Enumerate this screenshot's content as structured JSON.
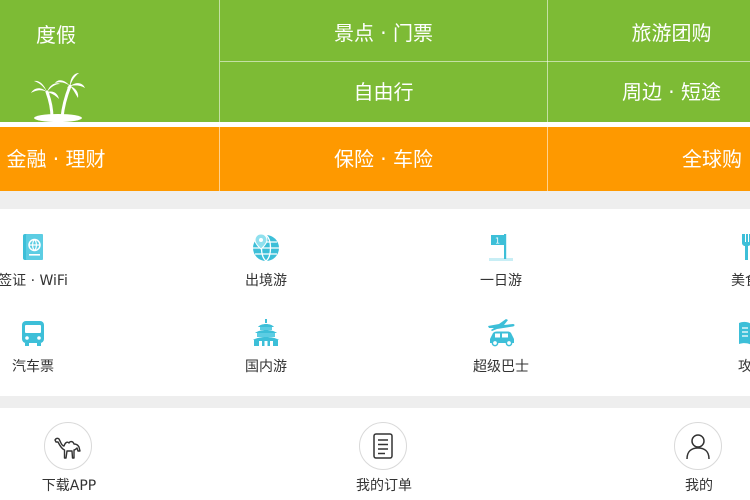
{
  "colors": {
    "green": "#7dbb35",
    "orange": "#fe9900",
    "icon_cyan": "#3dbfd8",
    "separator": "#eeeeee"
  },
  "green_menu": {
    "vacation": {
      "label": "度假",
      "icon": "palm-tree-icon"
    },
    "items": [
      {
        "label": "景点 · 门票"
      },
      {
        "label": "旅游团购"
      },
      {
        "label": "自由行"
      },
      {
        "label": "周边 · 短途"
      }
    ]
  },
  "orange_menu": {
    "items": [
      {
        "label": "金融 · 理财"
      },
      {
        "label": "保险 · 车险"
      },
      {
        "label": "全球购"
      }
    ]
  },
  "icon_grid": {
    "row1": [
      {
        "label": "签证 · WiFi",
        "icon": "passport-icon"
      },
      {
        "label": "出境游",
        "icon": "globe-pin-icon"
      },
      {
        "label": "一日游",
        "icon": "flag-icon"
      },
      {
        "label": "美食林",
        "icon": "utensils-icon"
      }
    ],
    "row2": [
      {
        "label": "汽车票",
        "icon": "bus-icon"
      },
      {
        "label": "国内游",
        "icon": "temple-icon"
      },
      {
        "label": "超级巴士",
        "icon": "plane-car-icon"
      },
      {
        "label": "攻略",
        "icon": "book-icon"
      }
    ]
  },
  "tab_bar": {
    "items": [
      {
        "label": "下载APP",
        "icon": "camel-icon"
      },
      {
        "label": "我的订单",
        "icon": "order-list-icon"
      },
      {
        "label": "我的",
        "icon": "user-icon"
      }
    ]
  }
}
